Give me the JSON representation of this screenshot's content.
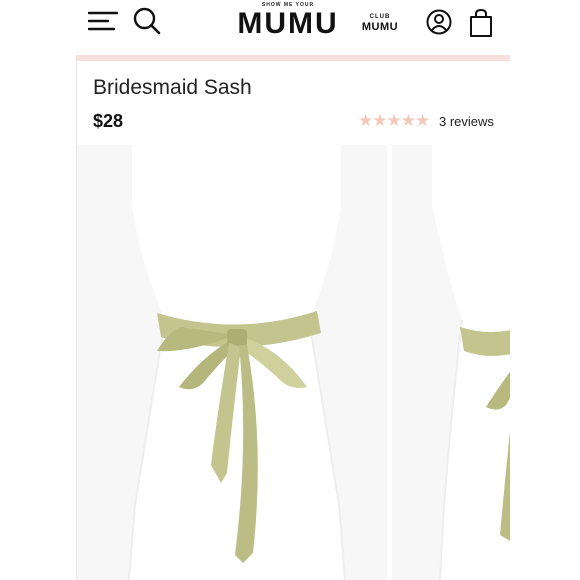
{
  "header": {
    "logo_small": "SHOW ME YOUR",
    "logo_main": "MUMU",
    "club_line1": "CLUB",
    "club_line2": "MUMU",
    "icons": [
      "hamburger-menu-icon",
      "search-icon",
      "account-icon",
      "shopping-bag-icon"
    ]
  },
  "product": {
    "title": "Bridesmaid Sash",
    "price": "$28",
    "rating_stars": "★★★★★",
    "rating": 4.5,
    "rating_max": 5,
    "reviews": "3 reviews"
  },
  "colors": {
    "accent_divider": "#f7e1dc",
    "star": "#f4c7bc",
    "sash": "#c4c58e",
    "text": "#222222"
  }
}
